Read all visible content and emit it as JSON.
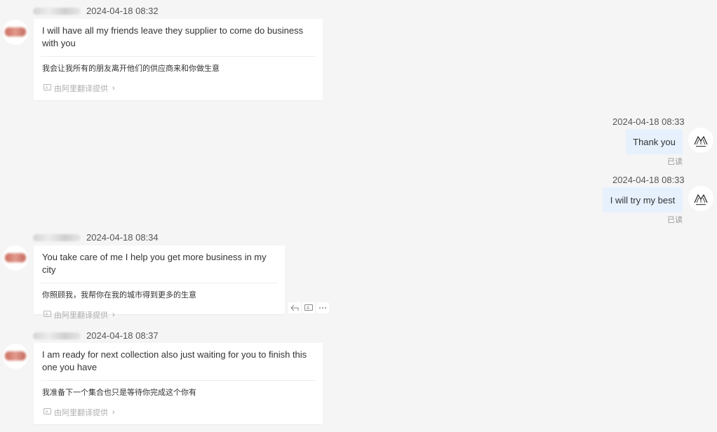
{
  "messages": [
    {
      "id": "m1",
      "timestamp": "2024-04-18 08:32",
      "text": "I will have all my friends leave they supplier to come do business with you",
      "translation": "我会让我所有的朋友离开他们的供应商来和你做生意",
      "provider": "由阿里翻译提供"
    },
    {
      "id": "m2",
      "timestamp": "2024-04-18 08:33",
      "text": "Thank you",
      "status": "已读"
    },
    {
      "id": "m3",
      "timestamp": "2024-04-18 08:33",
      "text": "I will try my best",
      "status": "已读"
    },
    {
      "id": "m4",
      "timestamp": "2024-04-18 08:34",
      "text": "You take care of me I help you get more business in my city",
      "translation": "你照顾我，我帮你在我的城市得到更多的生意",
      "provider": "由阿里翻译提供"
    },
    {
      "id": "m5",
      "timestamp": "2024-04-18 08:37",
      "text": "I am ready for next collection also just waiting for you to finish this one you have",
      "translation": "我准备下一个集合也只是等待你完成这个你有",
      "provider": "由阿里翻译提供"
    }
  ],
  "icons": {
    "provider": "translate-icon",
    "chevron": "chevron-right-icon",
    "reply": "reply-icon",
    "translate_action": "translate-icon",
    "more": "more-icon"
  },
  "colors": {
    "background": "#f5f5f5",
    "incoming_bubble": "#ffffff",
    "outgoing_bubble": "#e7f1fd",
    "muted_text": "#b0b0b0"
  }
}
